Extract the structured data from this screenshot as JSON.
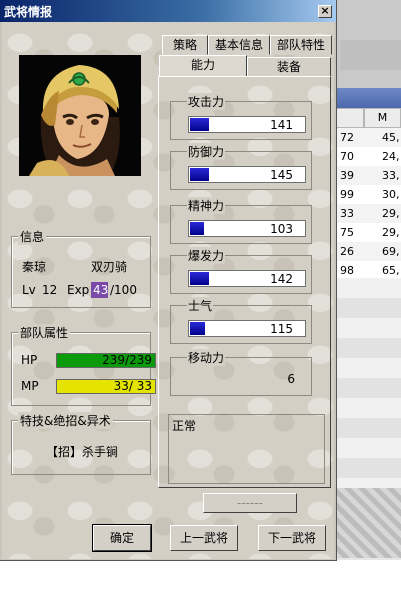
{
  "window": {
    "title": "武将情报",
    "close_glyph": "×"
  },
  "background_table": {
    "header_right": "M",
    "rows": [
      [
        "72",
        "45,"
      ],
      [
        "70",
        "24,"
      ],
      [
        "39",
        "33,"
      ],
      [
        "99",
        "30,"
      ],
      [
        "33",
        "29,"
      ],
      [
        "75",
        "29,"
      ],
      [
        "26",
        "69,"
      ],
      [
        "98",
        "65,"
      ]
    ]
  },
  "tabs": {
    "row_top": [
      "策略",
      "基本信息",
      "部队特性"
    ],
    "row_bottom": [
      "能力",
      "装备"
    ],
    "active": "能力"
  },
  "info": {
    "title": "信息",
    "name": "秦琼",
    "unit_type": "双刃骑",
    "lv_label": "Lv",
    "lv_value": "12",
    "exp_label": "Exp",
    "exp_value": "43",
    "exp_max": "/100",
    "exp_fraction": 0.43
  },
  "troop": {
    "title": "部队属性",
    "hp_label": "HP",
    "hp_text": "239/239",
    "hp_fraction": 1.0,
    "mp_label": "MP",
    "mp_text": "33/ 33",
    "mp_fraction": 1.0,
    "hp_color": "#0a9a0a",
    "mp_color": "#e4e400"
  },
  "skills": {
    "title": "特技&绝招&异术",
    "item": "【招】杀手锏"
  },
  "stats": [
    {
      "label": "攻击力",
      "value": "141"
    },
    {
      "label": "防御力",
      "value": "145"
    },
    {
      "label": "精神力",
      "value": "103"
    },
    {
      "label": "爆发力",
      "value": "142"
    },
    {
      "label": "士气",
      "value": "115"
    }
  ],
  "stat_max": 300,
  "move": {
    "label": "移动力",
    "value": "6"
  },
  "status": {
    "text": "正常"
  },
  "buttons": {
    "unnamed": "------",
    "confirm": "确定",
    "prev": "上一武将",
    "next": "下一武将"
  }
}
